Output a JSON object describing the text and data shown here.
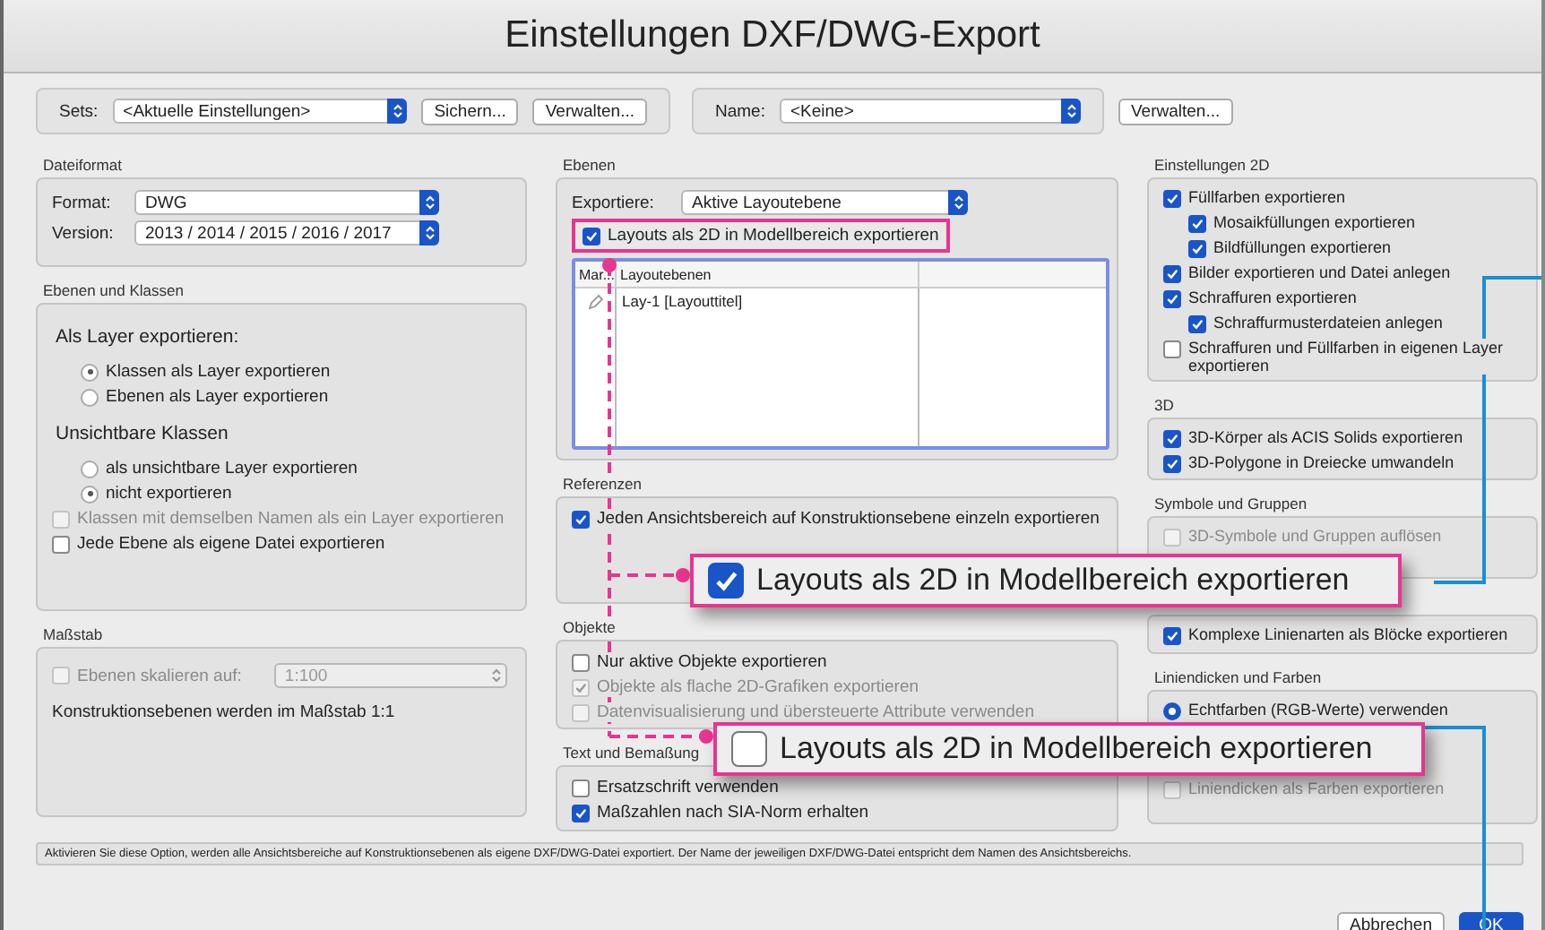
{
  "window": {
    "title": "Einstellungen DXF/DWG-Export"
  },
  "sets": {
    "label": "Sets:",
    "value": "<Aktuelle Einstellungen>",
    "buttons": [
      "Sichern...",
      "Verwalten..."
    ]
  },
  "name": {
    "label": "Name:",
    "value": "<Keine>",
    "button": "Verwalten..."
  },
  "columns": [
    {
      "sections": [
        {
          "title": "Dateiformat",
          "items": [
            {
              "kind": "select",
              "label": "Format:",
              "value": "DWG"
            },
            {
              "kind": "select",
              "label": "Version:",
              "value": "2013 / 2014 / 2015 / 2016 / 2017"
            }
          ]
        },
        {
          "title": "Ebenen und Klassen",
          "items": [
            {
              "kind": "heading",
              "label": "Als Layer exportieren:",
              "children": [
                {
                  "kind": "radio",
                  "label": "Klassen als Layer exportieren",
                  "selected": true
                },
                {
                  "kind": "radio",
                  "label": "Ebenen als Layer exportieren",
                  "selected": false
                }
              ]
            },
            {
              "kind": "heading",
              "label": "Unsichtbare Klassen",
              "children": [
                {
                  "kind": "radio",
                  "label": "als unsichtbare Layer exportieren",
                  "selected": false
                },
                {
                  "kind": "radio",
                  "label": "nicht exportieren",
                  "selected": true
                }
              ]
            },
            {
              "kind": "checkbox",
              "label": "Klassen mit demselben Namen als ein Layer exportieren",
              "checked": false,
              "disabled": true
            },
            {
              "kind": "checkbox",
              "label": "Jede Ebene als eigene Datei exportieren",
              "checked": false,
              "disabled": false
            }
          ]
        },
        {
          "title": "Maßstab",
          "items": [
            {
              "kind": "check_select",
              "label": "Ebenen skalieren auf:",
              "checked": false,
              "disabled": true,
              "value": "1:100"
            },
            {
              "kind": "text",
              "label": "Konstruktionsebenen werden im Maßstab 1:1"
            }
          ]
        }
      ]
    },
    {
      "sections": [
        {
          "title": "Ebenen",
          "items": [
            {
              "kind": "select",
              "label": "Exportiere:",
              "value": "Aktive Layoutebene"
            },
            {
              "kind": "checkbox",
              "label": "Layouts als 2D in Modellbereich exportieren",
              "checked": true,
              "disabled": false,
              "highlighted": true
            },
            {
              "kind": "table",
              "columns": [
                "Mar...",
                "Layoutebenen"
              ],
              "rows": [
                {
                  "name": "Lay-1 [Layouttitel]"
                }
              ]
            }
          ]
        },
        {
          "title": "Referenzen",
          "items": [
            {
              "kind": "checkbox",
              "label": "Jeden Ansichtsbereich auf Konstruktionsebene einzeln exportieren",
              "checked": true,
              "disabled": false
            }
          ]
        },
        {
          "title": "Objekte",
          "items": [
            {
              "kind": "checkbox",
              "label": "Nur aktive Objekte exportieren",
              "checked": false,
              "disabled": false
            },
            {
              "kind": "checkbox",
              "label": "Objekte als flache 2D-Grafiken exportieren",
              "checked": true,
              "disabled": true
            },
            {
              "kind": "checkbox",
              "label": "Datenvisualisierung und übersteuerte Attribute verwenden",
              "checked": false,
              "disabled": true
            }
          ]
        },
        {
          "title": "Text und Bemaßung",
          "items": [
            {
              "kind": "checkbox",
              "label": "Ersatzschrift verwenden",
              "checked": false,
              "disabled": false
            },
            {
              "kind": "checkbox",
              "label": "Maßzahlen nach SIA-Norm erhalten",
              "checked": true,
              "disabled": false
            }
          ]
        }
      ]
    },
    {
      "sections": [
        {
          "title": "Einstellungen 2D",
          "items": [
            {
              "kind": "checkbox",
              "label": "Füllfarben exportieren",
              "checked": true,
              "disabled": false,
              "children": [
                {
                  "kind": "checkbox",
                  "label": "Mosaikfüllungen exportieren",
                  "checked": true,
                  "disabled": false
                },
                {
                  "kind": "checkbox",
                  "label": "Bildfüllungen exportieren",
                  "checked": true,
                  "disabled": false
                }
              ]
            },
            {
              "kind": "checkbox",
              "label": "Bilder exportieren und Datei anlegen",
              "checked": true,
              "disabled": false
            },
            {
              "kind": "checkbox",
              "label": "Schraffuren exportieren",
              "checked": true,
              "disabled": false,
              "children": [
                {
                  "kind": "checkbox",
                  "label": "Schraffurmusterdateien anlegen",
                  "checked": true,
                  "disabled": false
                }
              ]
            },
            {
              "kind": "checkbox",
              "label": "Schraffuren und Füllfarben in eigenen Layer exportieren",
              "checked": false,
              "disabled": false
            }
          ]
        },
        {
          "title": "3D",
          "items": [
            {
              "kind": "checkbox",
              "label": "3D-Körper als ACIS Solids exportieren",
              "checked": true,
              "disabled": false
            },
            {
              "kind": "checkbox",
              "label": "3D-Polygone in Dreiecke umwandeln",
              "checked": true,
              "disabled": false
            }
          ]
        },
        {
          "title": "Symbole und Gruppen",
          "items": [
            {
              "kind": "checkbox",
              "label": "3D-Symbole und Gruppen auflösen",
              "checked": false,
              "disabled": true
            }
          ]
        },
        {
          "items": [
            {
              "kind": "checkbox",
              "label": "Komplexe Linienarten als Blöcke exportieren",
              "checked": true,
              "disabled": false
            }
          ]
        },
        {
          "title": "Liniendicken und Farben",
          "items": [
            {
              "kind": "radio",
              "label": "Echtfarben (RGB-Werte) verwenden",
              "selected": true
            },
            {
              "kind": "checkbox",
              "label": "Liniendicken als Farben exportieren",
              "checked": false,
              "disabled": true
            }
          ]
        }
      ]
    }
  ],
  "hint": "Aktivieren Sie diese Option, werden alle Ansichtsbereiche auf Konstruktionsebenen als eigene DXF/DWG-Datei exportiert. Der Name der jeweiligen DXF/DWG-Datei entspricht dem Namen des Ansichtsbereichs.",
  "buttons": [
    {
      "label": "Abbrechen",
      "kind": "default"
    },
    {
      "label": "OK",
      "kind": "primary"
    }
  ],
  "callouts": [
    {
      "label": "Layouts als 2D in Modellbereich exportieren",
      "checked": true
    },
    {
      "label": "Layouts als 2D in Modellbereich exportieren",
      "checked": false
    }
  ]
}
